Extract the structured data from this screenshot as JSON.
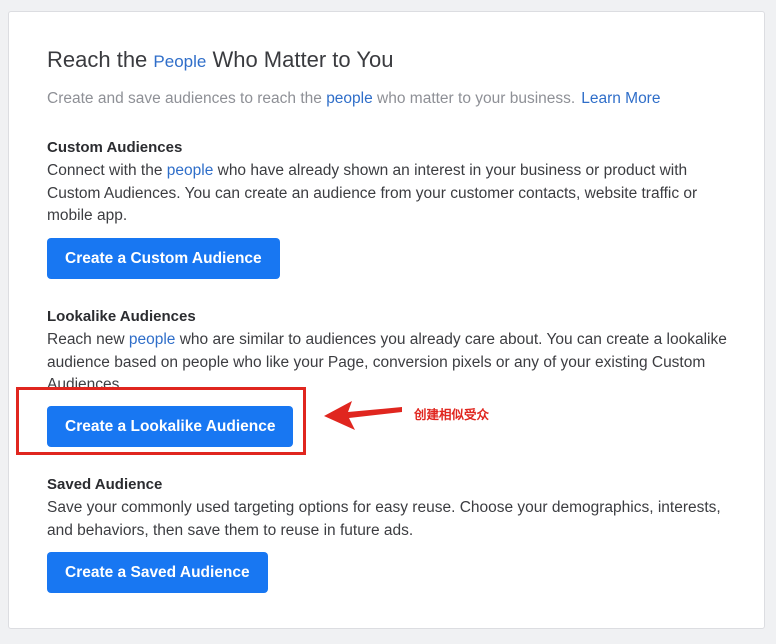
{
  "header": {
    "title_pre": "Reach the ",
    "title_highlight": "People",
    "title_post": " Who Matter to You",
    "subtitle_pre": "Create and save audiences to reach the ",
    "subtitle_highlight": "people",
    "subtitle_post": " who matter to your business.",
    "learn_more": "Learn More"
  },
  "custom": {
    "title": "Custom Audiences",
    "desc_pre": "Connect with the ",
    "desc_highlight": "people",
    "desc_post": " who have already shown an interest in your business or product with Custom Audiences. You can create an audience from your customer contacts, website traffic or mobile app.",
    "button": "Create a Custom Audience"
  },
  "lookalike": {
    "title": "Lookalike Audiences",
    "desc_pre": "Reach new ",
    "desc_highlight": "people",
    "desc_post": " who are similar to audiences you already care about. You can create a lookalike audience based on people who like your Page, conversion pixels or any of your existing Custom Audiences.",
    "button": "Create a Lookalike Audience"
  },
  "saved": {
    "title": "Saved Audience",
    "desc": "Save your commonly used targeting options for easy reuse. Choose your demographics, interests, and behaviors, then save them to reuse in future ads.",
    "button": "Create a Saved Audience"
  },
  "annotation": {
    "label": "创建相似受众",
    "color": "#e0261f"
  },
  "colors": {
    "accent": "#1877f2",
    "link": "#2f6ec9"
  }
}
